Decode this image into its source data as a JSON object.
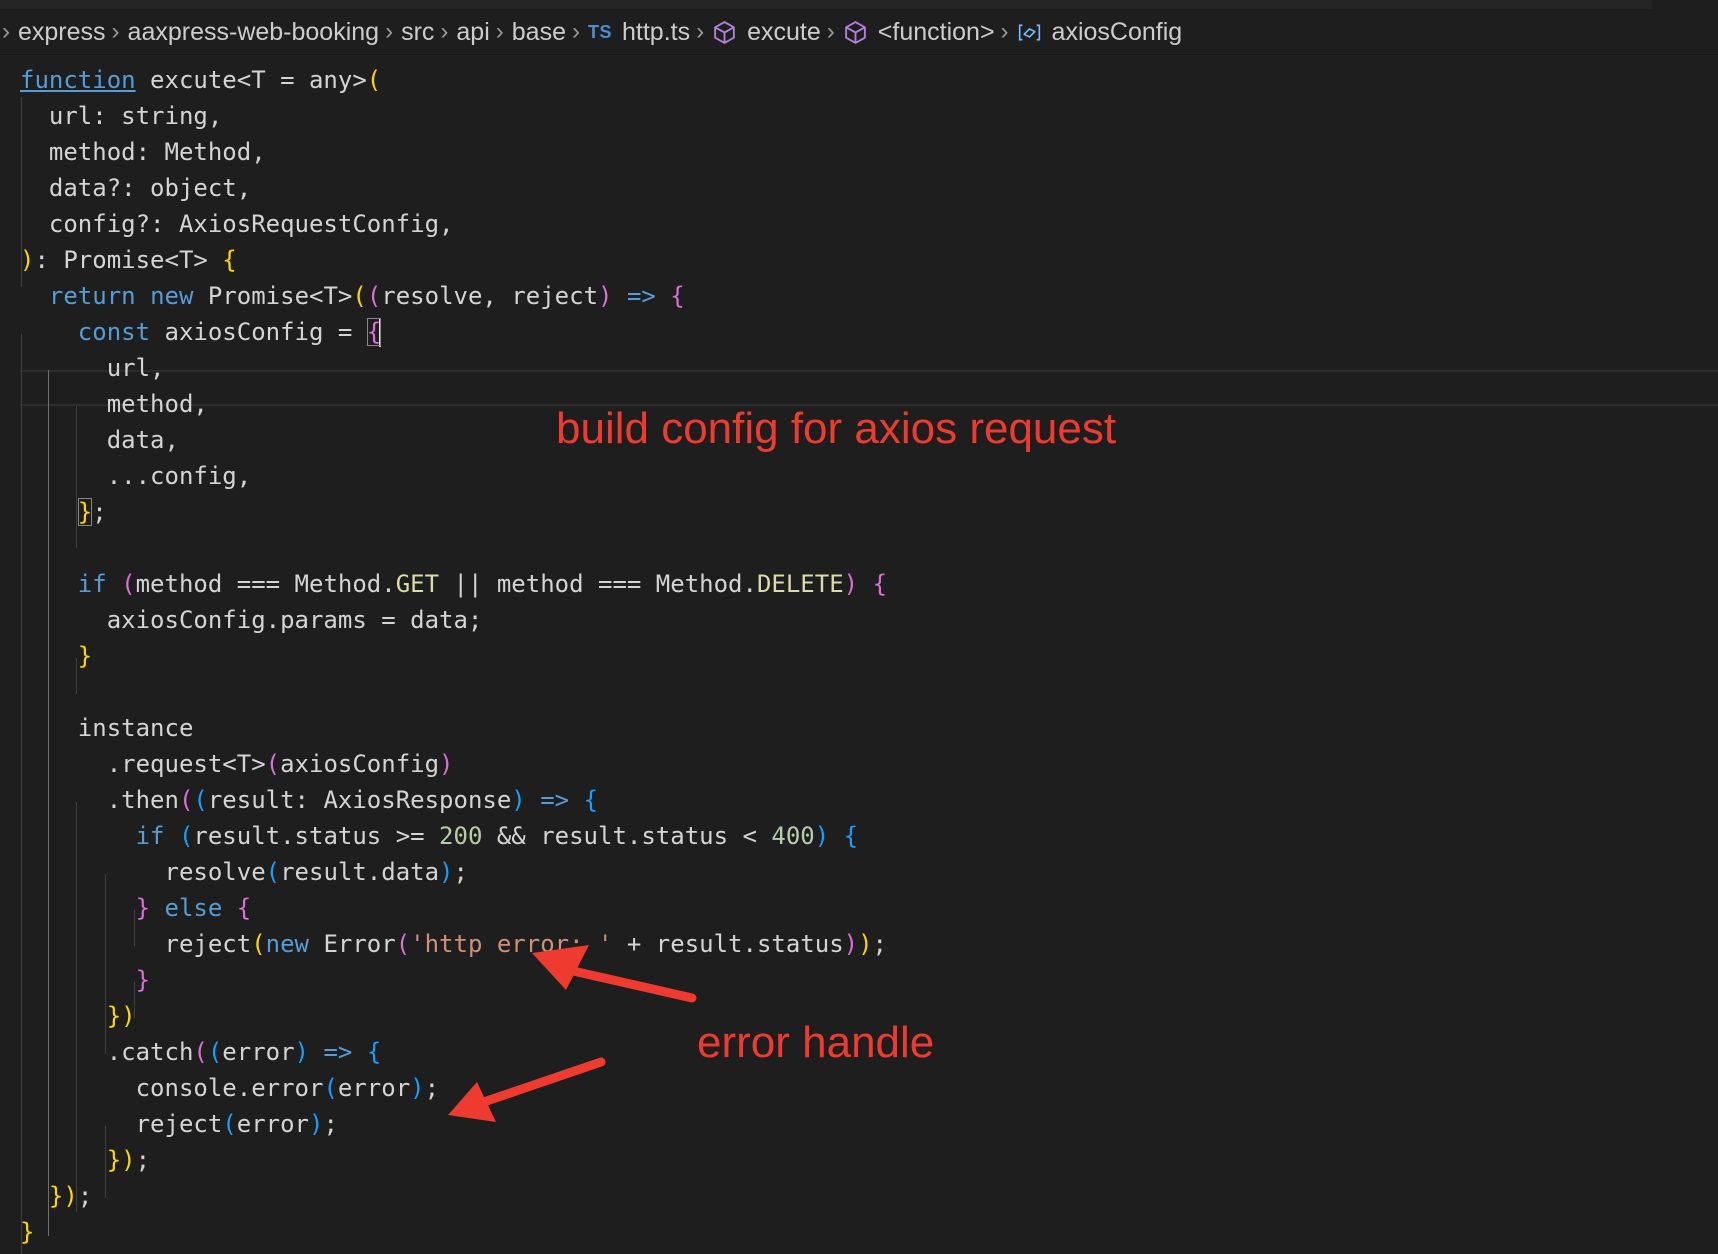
{
  "breadcrumb": {
    "items": [
      "express",
      "aaxpress-web-booking",
      "src",
      "api",
      "base",
      "http.ts",
      "excute",
      "<function>",
      "axiosConfig"
    ],
    "file_badge": "TS",
    "icons": [
      "chevron-right-icon",
      "typescript-file-icon",
      "cube-symbol-icon",
      "cube-symbol-icon",
      "variable-symbol-icon"
    ]
  },
  "code": {
    "lines": [
      "function excute<T = any>(",
      "  url: string,",
      "  method: Method,",
      "  data?: object,",
      "  config?: AxiosRequestConfig,",
      "): Promise<T> {",
      "  return new Promise<T>((resolve, reject) => {",
      "    const axiosConfig = {",
      "      url,",
      "      method,",
      "      data,",
      "      ...config,",
      "    };",
      "",
      "    if (method === Method.GET || method === Method.DELETE) {",
      "      axiosConfig.params = data;",
      "    }",
      "",
      "    instance",
      "      .request<T>(axiosConfig)",
      "      .then((result: AxiosResponse) => {",
      "        if (result.status >= 200 && result.status < 400) {",
      "          resolve(result.data);",
      "        } else {",
      "          reject(new Error('http error: ' + result.status));",
      "        }",
      "      })",
      "      .catch((error) => {",
      "        console.error(error);",
      "        reject(error);",
      "      });",
      "  });",
      "}"
    ]
  },
  "annotations": {
    "build": "build config for axios request",
    "error": "error handle",
    "color": "#ef3b2f"
  },
  "colors": {
    "background": "#1e1e1e",
    "keyword": "#569cd6",
    "control_keyword": "#c586c0",
    "string": "#ce9178",
    "number": "#b5cea8",
    "bracket_gold": "#ffd700",
    "bracket_orchid": "#da70d6",
    "bracket_blue": "#179fff"
  }
}
